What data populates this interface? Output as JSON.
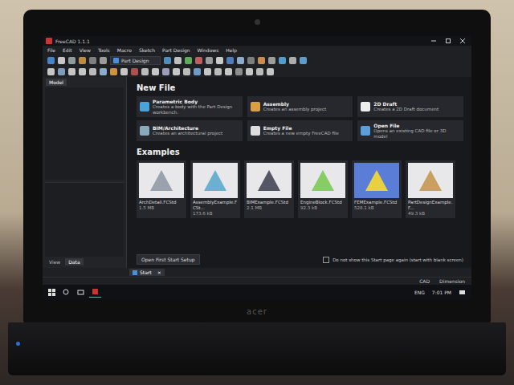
{
  "window": {
    "title": "FreeCAD 1.1.1"
  },
  "menu": [
    "File",
    "Edit",
    "View",
    "Tools",
    "Macro",
    "Sketch",
    "Part Design",
    "Windows",
    "Help"
  ],
  "workbench": {
    "label": "Part Design"
  },
  "combo_view": {
    "tabs": [
      {
        "label": "Model",
        "selected": true
      }
    ],
    "property_tabs": [
      {
        "label": "View",
        "selected": false
      },
      {
        "label": "Data",
        "selected": true
      }
    ]
  },
  "start_page": {
    "new_file_title": "New File",
    "new_file_items": [
      {
        "title": "Parametric Body",
        "description": "Creates a body with the Part Design workbench."
      },
      {
        "title": "Assembly",
        "description": "Creates an assembly project"
      },
      {
        "title": "2D Draft",
        "description": "Creates a 2D Draft document"
      },
      {
        "title": "BIM/Architecture",
        "description": "Creates an architectural project"
      },
      {
        "title": "Empty File",
        "description": "Creates a new empty FreeCAD file"
      },
      {
        "title": "Open File",
        "description": "Opens an existing CAD file or 3D model"
      }
    ],
    "examples_title": "Examples",
    "examples": [
      {
        "name": "ArchDetail.FCStd",
        "size": "1.5 MB"
      },
      {
        "name": "AssemblyExample.FCSt...",
        "size": "173.6 kB"
      },
      {
        "name": "BIMExample.FCStd",
        "size": "2.1 MB"
      },
      {
        "name": "EngineBlock.FCStd",
        "size": "92.3 kB"
      },
      {
        "name": "FEMExample.FCStd",
        "size": "528.1 kB"
      },
      {
        "name": "PartDesignExample.F...",
        "size": "49.3 kB"
      }
    ],
    "setup_button": "Open First Start Setup",
    "dont_show": {
      "label": "Do not show this Start page again (start with blank screen)",
      "checked": false
    }
  },
  "document_tabs": [
    {
      "label": "Start",
      "selected": true,
      "close": "×"
    }
  ],
  "status_bar": {
    "items": [
      "CAD",
      "Dimension"
    ]
  },
  "taskbar": {
    "language": "ENG",
    "time": "7:01 PM"
  },
  "laptop": {
    "brand": "acer"
  }
}
